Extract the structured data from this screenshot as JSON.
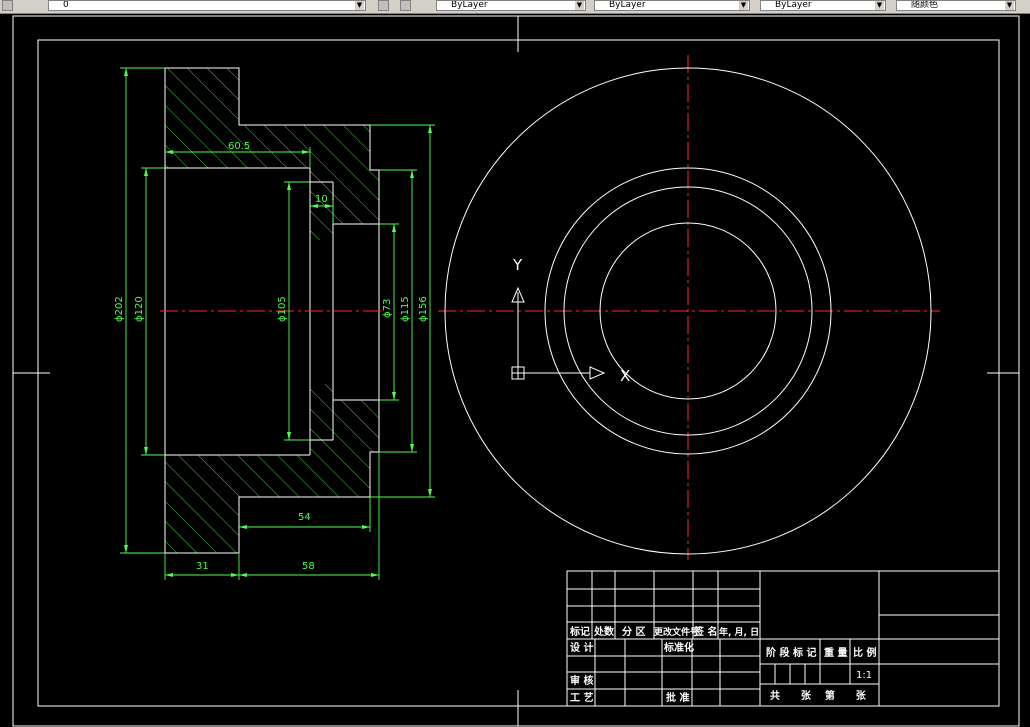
{
  "toolbar": {
    "layer_value": "0",
    "color_value": "ByLayer",
    "linetype_value": "ByLayer",
    "lineweight_value": "ByLayer",
    "plotstyle_value": "随颜色"
  },
  "drawing": {
    "dimensions": {
      "d_outer": "ϕ202",
      "d_bore": "ϕ120",
      "len_605": "60.5",
      "len_10": "10",
      "d_105": "ϕ105",
      "d_73": "ϕ73",
      "d_115": "ϕ115",
      "d_156": "ϕ156",
      "len_54": "54",
      "len_31": "31",
      "len_58": "58"
    },
    "ucs": {
      "y_label": "Y",
      "x_label": "X"
    },
    "title_block": {
      "row_headers": [
        "标记",
        "处数",
        "分 区",
        "更改文件号",
        "签 名",
        "年, 月, 日"
      ],
      "design": "设 计",
      "standardize": "标准化",
      "stage_mark": "阶 段 标 记",
      "weight": "重 量",
      "scale_label": "比 例",
      "scale_value": "1:1",
      "review": "审 核",
      "process": "工 艺",
      "approve": "批 准",
      "sheets": "共      张    第      张"
    }
  },
  "colors": {
    "background": "#000000",
    "outline": "#ffffff",
    "dimension": "#4cff4c",
    "centerline": "#ff2a2a",
    "hatch": "#4cff4c"
  }
}
